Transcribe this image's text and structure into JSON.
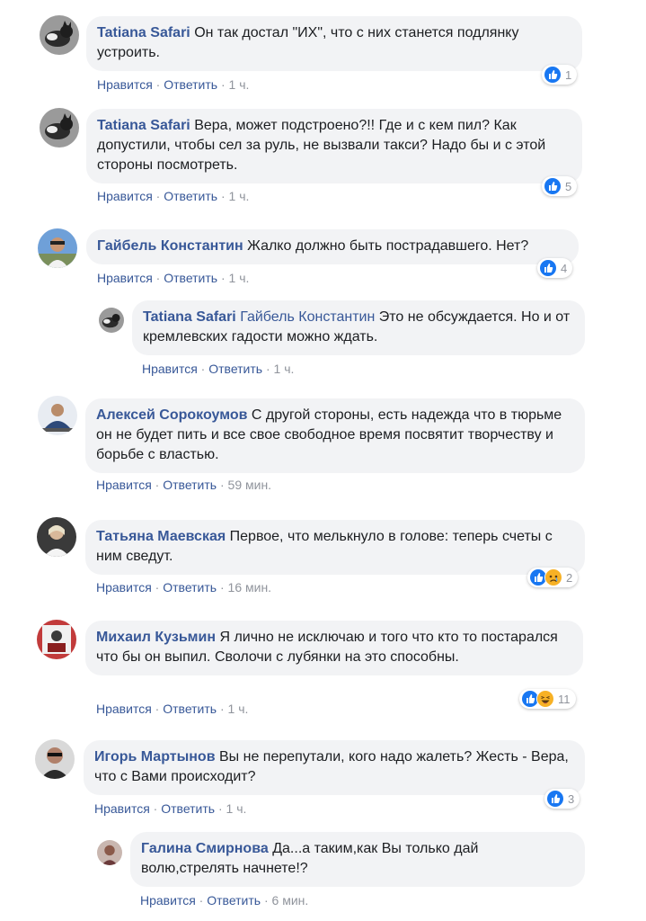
{
  "labels": {
    "like": "Нравится",
    "reply": "Ответить",
    "sep": "·"
  },
  "colors": {
    "author": "#385898",
    "bubble": "#f2f3f5",
    "meta": "#90949c",
    "like_blue": "#1877f2"
  },
  "comments": [
    {
      "author": "Tatiana Safari",
      "text": "Он так достал \"ИХ\", что с них станется подлянку устроить.",
      "time": "1 ч.",
      "reaction_count": "1",
      "reactions": [
        "like-icon"
      ]
    },
    {
      "author": "Tatiana Safari",
      "text": "Вера, может подстроено?!! Где и с кем пил? Как допустили, чтобы сел за руль, не вызвали такси? Надо бы и с этой стороны посмотреть.",
      "time": "1 ч.",
      "reaction_count": "5",
      "reactions": [
        "like-icon"
      ]
    },
    {
      "author": "Гайбель Константин",
      "text": "Жалко должно быть пострадавшего. Нет?",
      "time": "1 ч.",
      "reaction_count": "4",
      "reactions": [
        "like-icon"
      ]
    },
    {
      "author": "Tatiana Safari",
      "mention": "Гайбель Константин",
      "text": "Это не обсуждается. Но и от кремлевских гадости можно ждать.",
      "time": "1 ч."
    },
    {
      "author": "Алексей Сорокоумов",
      "text": "С другой стороны, есть надежда что в тюрьме он не будет пить и все свое свободное время посвятит творчеству и борьбе с властью.",
      "time": "59 мин."
    },
    {
      "author": "Татьяна Маевская",
      "text": "Первое, что мелькнуло в голове: теперь счеты с ним сведут.",
      "time": "16 мин.",
      "reaction_count": "2",
      "reactions": [
        "like-icon",
        "sad-icon"
      ]
    },
    {
      "author": "Михаил Кузьмин",
      "text": "Я лично не исключаю и того что кто то постарался что бы он выпил. Сволочи с лубянки на это способны.",
      "time": "1 ч.",
      "reaction_count": "11",
      "reactions": [
        "like-icon",
        "haha-icon"
      ]
    },
    {
      "author": "Игорь Мартынов",
      "text": "Вы не перепутали, кого надо жалеть? Жесть - Вера, что с Вами происходит?",
      "time": "1 ч.",
      "reaction_count": "3",
      "reactions": [
        "like-icon"
      ]
    },
    {
      "author": "Галина Смирнова",
      "text": "Да...а таким,как Вы только дай волю,стрелять начнете!?",
      "time": "6 мин."
    }
  ]
}
